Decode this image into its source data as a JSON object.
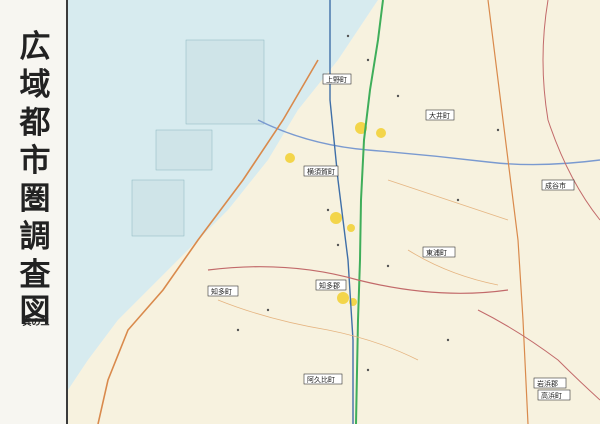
{
  "title_chars": [
    "広",
    "域",
    "都",
    "市",
    "圏",
    "調",
    "査",
    "図"
  ],
  "subtitle": "其の二",
  "towns": [
    {
      "id": "town-1",
      "text": "上野町"
    },
    {
      "id": "town-2",
      "text": "大井町"
    },
    {
      "id": "town-3",
      "text": "横須賀町"
    },
    {
      "id": "town-4",
      "text": "成谷市"
    },
    {
      "id": "town-5",
      "text": "東浦町"
    },
    {
      "id": "town-6",
      "text": "知多町"
    },
    {
      "id": "town-7",
      "text": "知多郡"
    },
    {
      "id": "town-8",
      "text": "阿久比町"
    },
    {
      "id": "town-9",
      "text": "岩浜郡"
    },
    {
      "id": "town-10",
      "text": "高浜町"
    }
  ],
  "colors": {
    "paper": "#f3f1e8",
    "sea": "#d7ebef",
    "land": "#f7f2df",
    "road_main": "#d98a4c",
    "railway": "#3f6fa8",
    "expressway": "#7a9ad0",
    "green_line": "#3fae5a",
    "boundary": "#c26a6a",
    "built_area": "#f2d13a"
  }
}
